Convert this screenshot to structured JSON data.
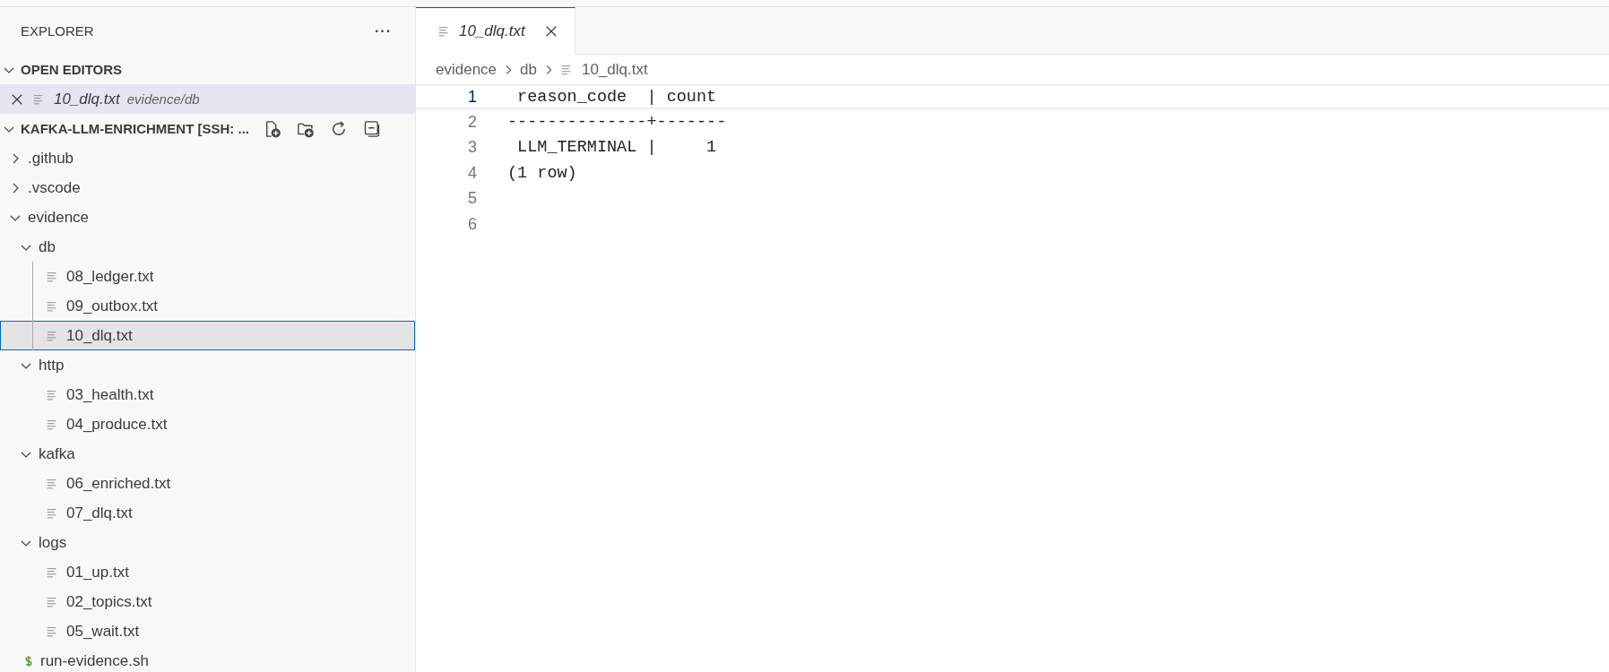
{
  "explorer": {
    "title": "EXPLORER",
    "more": "···"
  },
  "open_editors": {
    "title": "OPEN EDITORS",
    "expanded": true,
    "items": [
      {
        "name": "10_dlq.txt",
        "path": "evidence/db",
        "preview": true,
        "selected": true
      }
    ]
  },
  "workspace": {
    "title": "KAFKA-LLM-ENRICHMENT [SSH: ...",
    "expanded": true,
    "tree": [
      {
        "name": ".github",
        "kind": "folder",
        "expanded": false,
        "selected": false
      },
      {
        "name": ".vscode",
        "kind": "folder",
        "expanded": false,
        "selected": false
      },
      {
        "name": "evidence",
        "kind": "folder",
        "expanded": true,
        "selected": false,
        "children": [
          {
            "name": "db",
            "kind": "folder",
            "expanded": true,
            "selected": false,
            "children": [
              {
                "name": "08_ledger.txt",
                "kind": "text",
                "selected": false
              },
              {
                "name": "09_outbox.txt",
                "kind": "text",
                "selected": false
              },
              {
                "name": "10_dlq.txt",
                "kind": "text",
                "selected": true
              }
            ]
          },
          {
            "name": "http",
            "kind": "folder",
            "expanded": true,
            "selected": false,
            "children": [
              {
                "name": "03_health.txt",
                "kind": "text",
                "selected": false
              },
              {
                "name": "04_produce.txt",
                "kind": "text",
                "selected": false
              }
            ]
          },
          {
            "name": "kafka",
            "kind": "folder",
            "expanded": true,
            "selected": false,
            "children": [
              {
                "name": "06_enriched.txt",
                "kind": "text",
                "selected": false
              },
              {
                "name": "07_dlq.txt",
                "kind": "text",
                "selected": false
              }
            ]
          },
          {
            "name": "logs",
            "kind": "folder",
            "expanded": true,
            "selected": false,
            "children": [
              {
                "name": "01_up.txt",
                "kind": "text",
                "selected": false
              },
              {
                "name": "02_topics.txt",
                "kind": "text",
                "selected": false
              },
              {
                "name": "05_wait.txt",
                "kind": "text",
                "selected": false
              }
            ]
          }
        ]
      },
      {
        "name": "run-evidence.sh",
        "kind": "script",
        "selected": false
      }
    ]
  },
  "editor": {
    "tabs": [
      {
        "label": "10_dlq.txt",
        "preview": true,
        "selected": true
      }
    ],
    "breadcrumb": [
      {
        "label": "evidence",
        "kind": "folder"
      },
      {
        "label": "db",
        "kind": "folder"
      },
      {
        "label": "10_dlq.txt",
        "kind": "text"
      }
    ],
    "lines": [
      {
        "number": "1",
        "text": " reason_code  | count",
        "current": true
      },
      {
        "number": "2",
        "text": "--------------+-------",
        "current": false
      },
      {
        "number": "3",
        "text": " LLM_TERMINAL |     1",
        "current": false
      },
      {
        "number": "4",
        "text": "(1 row)",
        "current": false
      },
      {
        "number": "5",
        "current": false
      },
      {
        "number": "6",
        "current": false
      }
    ]
  }
}
